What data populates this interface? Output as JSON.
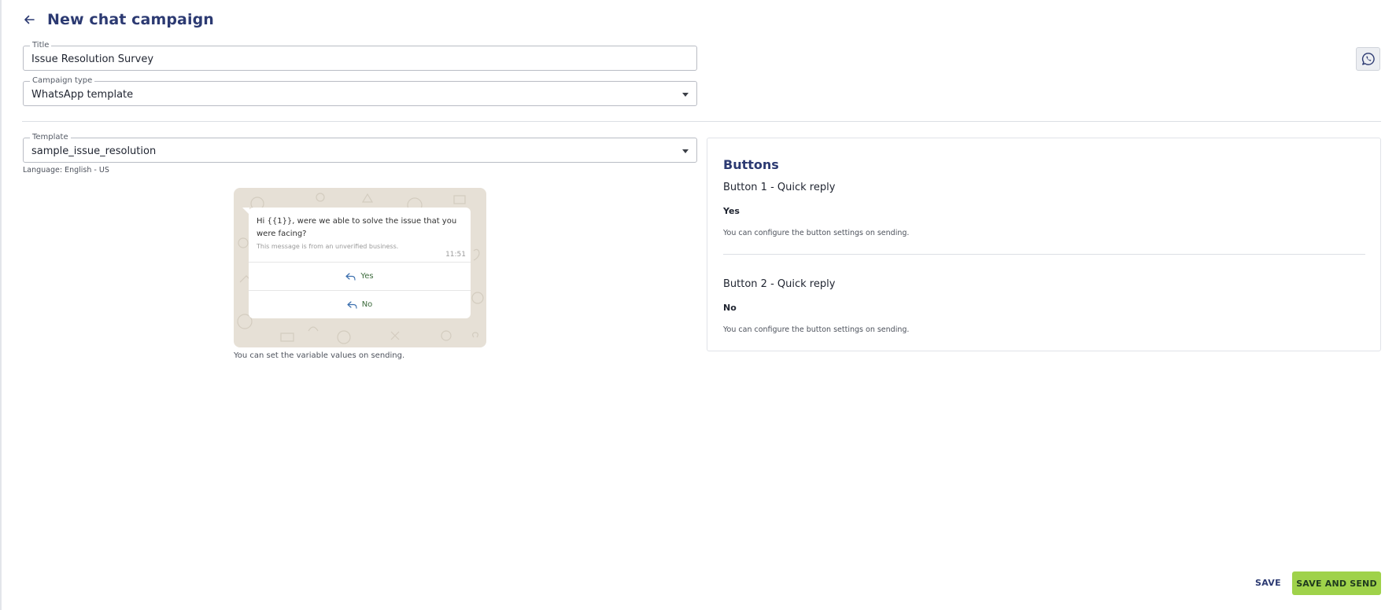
{
  "header": {
    "title": "New chat campaign"
  },
  "form": {
    "title": {
      "label": "Title",
      "value": "Issue Resolution Survey"
    },
    "campaign_type": {
      "label": "Campaign type",
      "value": "WhatsApp template"
    },
    "template": {
      "label": "Template",
      "value": "sample_issue_resolution",
      "language": "Language: English - US"
    }
  },
  "preview": {
    "message": "Hi {{1}}, were we able to solve the issue that you were facing?",
    "business_note": "This message is from an unverified business.",
    "time": "11:51",
    "replies": [
      "Yes",
      "No"
    ],
    "note": "You can set the variable values on sending."
  },
  "buttons_panel": {
    "title": "Buttons",
    "items": [
      {
        "heading": "Button 1 - Quick reply",
        "value": "Yes",
        "note": "You can configure the button settings on sending."
      },
      {
        "heading": "Button 2 - Quick reply",
        "value": "No",
        "note": "You can configure the button settings on sending."
      }
    ]
  },
  "actions": {
    "save": "SAVE",
    "save_and_send": "SAVE AND SEND"
  },
  "icons": {
    "back": "arrow-left-icon",
    "whatsapp": "whatsapp-icon",
    "reply": "reply-arrow-icon",
    "dropdown": "caret-down-icon"
  },
  "colors": {
    "title": "#2c3a72",
    "primary_button": "#9fd24a",
    "preview_background": "#e6e0d6"
  }
}
